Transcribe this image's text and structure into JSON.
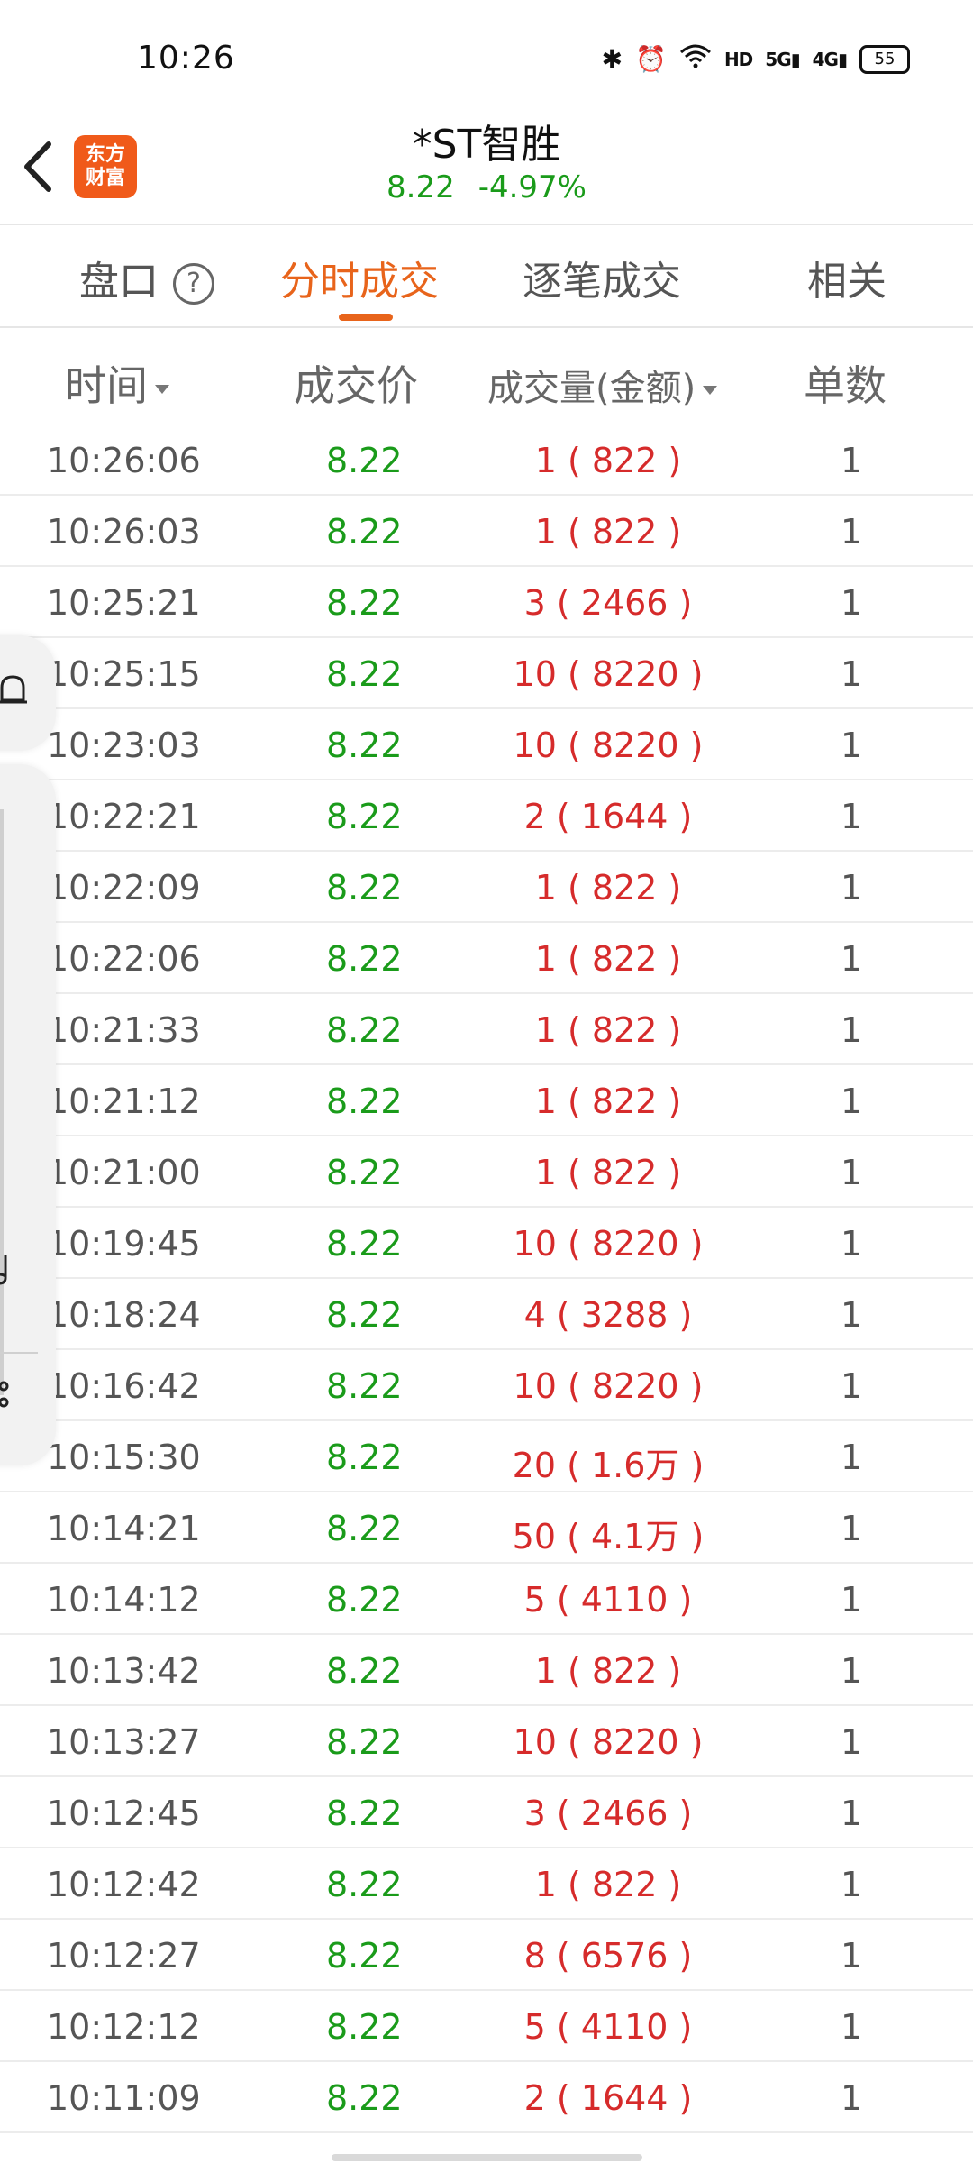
{
  "status_bar": {
    "time": "10:26",
    "network_label": "HD",
    "signal_5g": "5G",
    "signal_4g": "4G",
    "battery": "55"
  },
  "header": {
    "logo_text_line1": "东方",
    "logo_text_line2": "财富",
    "title": "*ST智胜",
    "price": "8.22",
    "change_pct": "-4.97%"
  },
  "tabs": [
    {
      "label": "盘口",
      "active": false
    },
    {
      "label": "分时成交",
      "active": true
    },
    {
      "label": "逐笔成交",
      "active": false
    },
    {
      "label": "相关",
      "active": false
    }
  ],
  "columns": {
    "time": "时间",
    "price": "成交价",
    "volume": "成交量(金额)",
    "count": "单数"
  },
  "rows": [
    {
      "time": "10:26:06",
      "price": "8.22",
      "volume": "1 ( 822 )",
      "count": "1"
    },
    {
      "time": "10:26:03",
      "price": "8.22",
      "volume": "1 ( 822 )",
      "count": "1"
    },
    {
      "time": "10:25:21",
      "price": "8.22",
      "volume": "3 ( 2466 )",
      "count": "1"
    },
    {
      "time": "10:25:15",
      "price": "8.22",
      "volume": "10 ( 8220 )",
      "count": "1"
    },
    {
      "time": "10:23:03",
      "price": "8.22",
      "volume": "10 ( 8220 )",
      "count": "1"
    },
    {
      "time": "10:22:21",
      "price": "8.22",
      "volume": "2 ( 1644 )",
      "count": "1"
    },
    {
      "time": "10:22:09",
      "price": "8.22",
      "volume": "1 ( 822 )",
      "count": "1"
    },
    {
      "time": "10:22:06",
      "price": "8.22",
      "volume": "1 ( 822 )",
      "count": "1"
    },
    {
      "time": "10:21:33",
      "price": "8.22",
      "volume": "1 ( 822 )",
      "count": "1"
    },
    {
      "time": "10:21:12",
      "price": "8.22",
      "volume": "1 ( 822 )",
      "count": "1"
    },
    {
      "time": "10:21:00",
      "price": "8.22",
      "volume": "1 ( 822 )",
      "count": "1"
    },
    {
      "time": "10:19:45",
      "price": "8.22",
      "volume": "10 ( 8220 )",
      "count": "1"
    },
    {
      "time": "10:18:24",
      "price": "8.22",
      "volume": "4 ( 3288 )",
      "count": "1"
    },
    {
      "time": "10:16:42",
      "price": "8.22",
      "volume": "10 ( 8220 )",
      "count": "1"
    },
    {
      "time": "10:15:30",
      "price": "8.22",
      "volume": "20 ( 1.6万 )",
      "count": "1"
    },
    {
      "time": "10:14:21",
      "price": "8.22",
      "volume": "50 ( 4.1万 )",
      "count": "1"
    },
    {
      "time": "10:14:12",
      "price": "8.22",
      "volume": "5 ( 4110 )",
      "count": "1"
    },
    {
      "time": "10:13:42",
      "price": "8.22",
      "volume": "1 ( 822 )",
      "count": "1"
    },
    {
      "time": "10:13:27",
      "price": "8.22",
      "volume": "10 ( 8220 )",
      "count": "1"
    },
    {
      "time": "10:12:45",
      "price": "8.22",
      "volume": "3 ( 2466 )",
      "count": "1"
    },
    {
      "time": "10:12:42",
      "price": "8.22",
      "volume": "1 ( 822 )",
      "count": "1"
    },
    {
      "time": "10:12:27",
      "price": "8.22",
      "volume": "8 ( 6576 )",
      "count": "1"
    },
    {
      "time": "10:12:12",
      "price": "8.22",
      "volume": "5 ( 4110 )",
      "count": "1"
    },
    {
      "time": "10:11:09",
      "price": "8.22",
      "volume": "2 ( 1644 )",
      "count": "1"
    }
  ],
  "colors": {
    "accent": "#e8641b",
    "price_down": "#1a9b1a",
    "volume": "#d62b2b"
  }
}
